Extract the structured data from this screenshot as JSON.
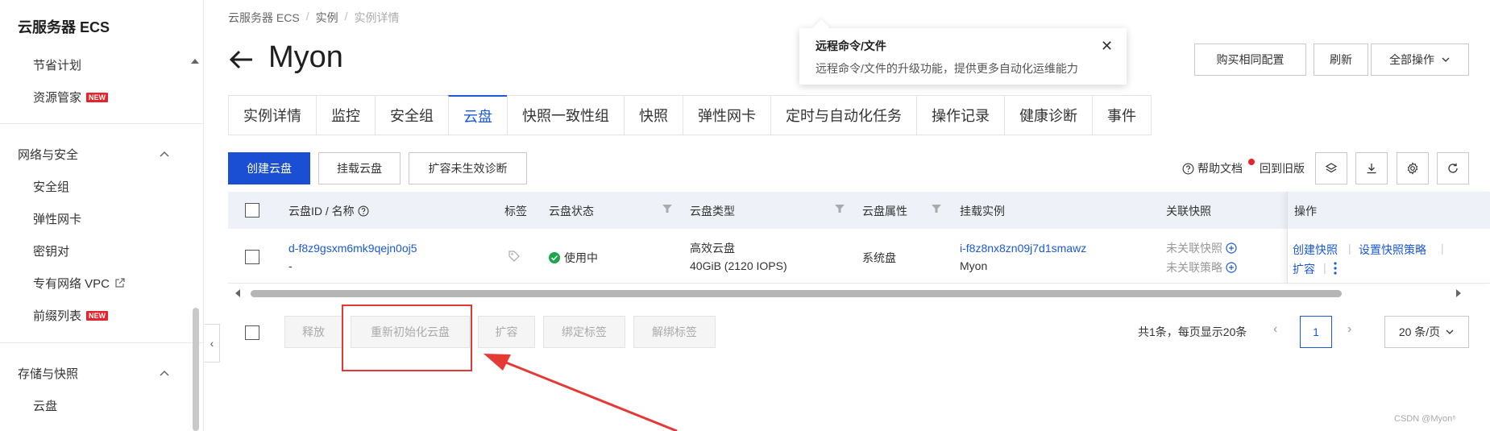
{
  "sidebar": {
    "title": "云服务器 ECS",
    "items_top": [
      {
        "label": "节省计划"
      },
      {
        "label": "资源管家",
        "badge": "NEW"
      }
    ],
    "group_network": {
      "label": "网络与安全",
      "items": [
        {
          "label": "安全组"
        },
        {
          "label": "弹性网卡"
        },
        {
          "label": "密钥对"
        },
        {
          "label": "专有网络 VPC"
        },
        {
          "label": "前缀列表",
          "badge": "NEW"
        }
      ]
    },
    "group_storage": {
      "label": "存储与快照",
      "items": [
        {
          "label": "云盘"
        }
      ]
    }
  },
  "breadcrumb": [
    "云服务器 ECS",
    "实例",
    "实例详情"
  ],
  "page_title": "Myon",
  "popover": {
    "title": "远程命令/文件",
    "desc": "远程命令/文件的升级功能，提供更多自动化运维能力"
  },
  "header_buttons": {
    "buy_same": "购买相同配置",
    "refresh": "刷新",
    "all_ops": "全部操作"
  },
  "tabs": [
    "实例详情",
    "监控",
    "安全组",
    "云盘",
    "快照一致性组",
    "快照",
    "弹性网卡",
    "定时与自动化任务",
    "操作记录",
    "健康诊断",
    "事件"
  ],
  "active_tab": "云盘",
  "toolbar": {
    "create": "创建云盘",
    "attach": "挂载云盘",
    "diagnose": "扩容未生效诊断",
    "help": "帮助文档",
    "old_version": "回到旧版"
  },
  "table": {
    "headers": {
      "id_name": "云盘ID / 名称",
      "tag": "标签",
      "status": "云盘状态",
      "type": "云盘类型",
      "attr": "云盘属性",
      "instance": "挂载实例",
      "snapshot": "关联快照",
      "ops": "操作"
    },
    "rows": [
      {
        "id": "d-f8z9gsxm6mk9qejn0oj5",
        "name": "-",
        "status": "使用中",
        "type": "高效云盘",
        "spec": "40GiB (2120 IOPS)",
        "attr": "系统盘",
        "instance_id": "i-f8z8nx8zn09j7d1smawz",
        "instance_name": "Myon",
        "snapshot": "未关联快照",
        "policy": "未关联策略",
        "ops": [
          "创建快照",
          "设置快照策略",
          "扩容"
        ]
      }
    ]
  },
  "bulk": {
    "release": "释放",
    "reinit": "重新初始化云盘",
    "expand": "扩容",
    "bind_tag": "绑定标签",
    "unbind_tag": "解绑标签"
  },
  "pagination": {
    "total": "共1条，每页显示20条",
    "page": "1",
    "page_size": "20 条/页"
  },
  "watermark": "CSDN @Myon⁵",
  "colors": {
    "primary": "#1a4fd3",
    "link": "#1a5ad6",
    "success": "#1aa64b",
    "danger": "#e53935"
  }
}
